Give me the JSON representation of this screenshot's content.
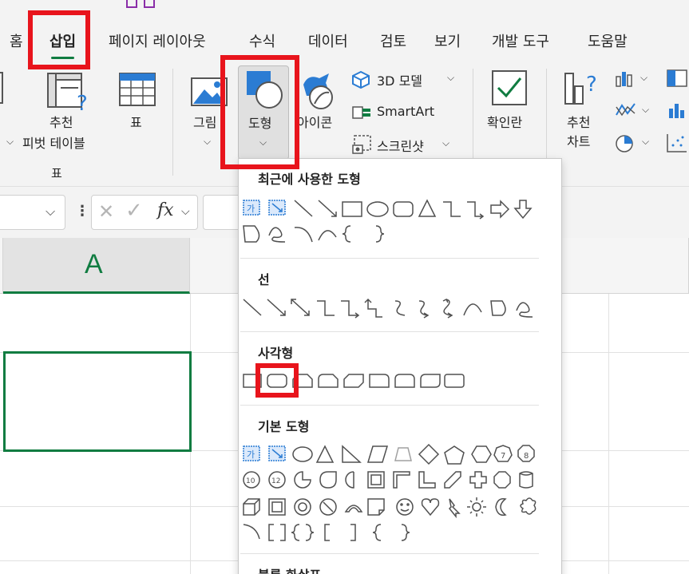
{
  "tabs": [
    {
      "label": "홈",
      "active": false
    },
    {
      "label": "삽입",
      "active": true
    },
    {
      "label": "페이지 레이아웃",
      "active": false
    },
    {
      "label": "수식",
      "active": false
    },
    {
      "label": "데이터",
      "active": false
    },
    {
      "label": "검토",
      "active": false
    },
    {
      "label": "보기",
      "active": false
    },
    {
      "label": "개발 도구",
      "active": false
    },
    {
      "label": "도움말",
      "active": false
    }
  ],
  "ribbon": {
    "pivot_label_1": "추천",
    "pivot_label_2": "피벗 테이블",
    "table_label": "표",
    "group_tables": "표",
    "pictures_label": "그림",
    "shapes_label": "도형",
    "icons_label": "아이콘",
    "model3d_label": "3D 모델",
    "smartart_label": "SmartArt",
    "screenshot_label": "스크린샷",
    "checkbox_label": "확인란",
    "charts_label_1": "추천",
    "charts_label_2": "차트"
  },
  "formula_bar": {
    "cancel_symbol": "✕",
    "enter_symbol": "✓",
    "fx_symbol": "fx"
  },
  "grid": {
    "column_a": "A"
  },
  "shapes_menu": {
    "sections": [
      {
        "title": "최근에 사용한 도형"
      },
      {
        "title": "선"
      },
      {
        "title": "사각형"
      },
      {
        "title": "기본 도형"
      },
      {
        "title": "블록 화살표"
      }
    ],
    "textbox_glyph": "가",
    "octagon_7": "7",
    "octagon_8": "8",
    "decagon_10": "10",
    "dodecagon_12": "12"
  },
  "colors": {
    "accent": "#107c41",
    "highlight": "#e8141c",
    "shape_icon_blue": "#2b7cd3"
  }
}
